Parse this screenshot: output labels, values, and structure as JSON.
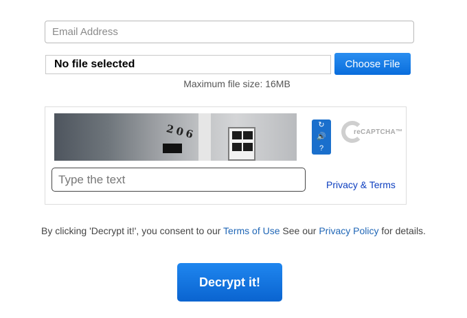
{
  "email": {
    "placeholder": "Email Address",
    "value": ""
  },
  "file_upload": {
    "selected_text": "No file selected",
    "choose_label": "Choose File",
    "max_size_text": "Maximum file size: 16MB"
  },
  "captcha": {
    "image_digits": "206",
    "reload_icon": "reload-icon",
    "audio_icon": "audio-icon",
    "help_icon": "help-icon",
    "logo_text": "reCAPTCHA™",
    "input_placeholder": "Type the text",
    "privacy_terms_label": "Privacy & Terms"
  },
  "consent": {
    "prefix": "By clicking 'Decrypt it!', you consent to our ",
    "terms_link": "Terms of Use",
    "middle": " See our ",
    "privacy_link": "Privacy Policy",
    "suffix": " for details."
  },
  "decrypt_button": {
    "label": "Decrypt it!"
  },
  "colors": {
    "button_blue": "#0a6ddc",
    "link_blue": "#1f66b6",
    "captcha_link_blue": "#0b3dbf"
  }
}
